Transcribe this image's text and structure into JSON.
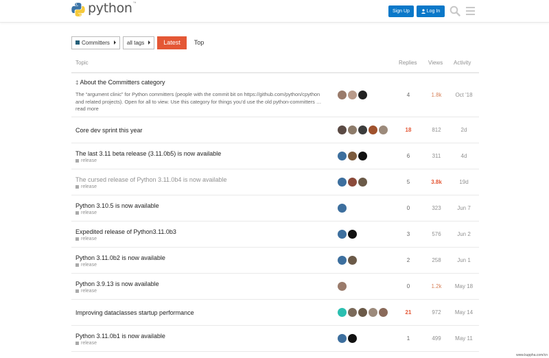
{
  "header": {
    "brand": "python",
    "trademark": "™",
    "signup_label": "Sign Up",
    "login_label": "Log In",
    "search_icon": "search-icon",
    "menu_icon": "hamburger-menu-icon"
  },
  "nav": {
    "category_label": "Committers",
    "tags_label": "all tags",
    "latest_label": "Latest",
    "top_label": "Top"
  },
  "columns": {
    "topic": "Topic",
    "replies": "Replies",
    "views": "Views",
    "activity": "Activity"
  },
  "topics": [
    {
      "pinned": true,
      "title": "About the Committers category",
      "excerpt": "The “argument clinic” for Python committers (people with the commit bit on https://github.com/python/cpython and related projects). Open for all to view. Use this category for things you’d use the old python-committers … read more",
      "tag": "",
      "avatars": [
        "#9a7b6b",
        "#b89a8a",
        "#222222"
      ],
      "replies": "4",
      "views": "1.8k",
      "activity": "Oct '18"
    },
    {
      "title": "Core dev sprint this year",
      "tag": "",
      "avatars": [
        "#5a4a44",
        "#8d7b6a",
        "#3c3c3c",
        "#a0522d",
        "#9c8a7b"
      ],
      "replies": "18",
      "views": "812",
      "activity": "2d"
    },
    {
      "title": "The last 3.11 beta release (3.11.0b5) is now available",
      "tag": "release",
      "avatars": [
        "#3d6f9e",
        "#7b5a3d",
        "#111111"
      ],
      "replies": "6",
      "views": "311",
      "activity": "4d"
    },
    {
      "title": "The cursed release of Python 3.11.0b4 is now available",
      "muted": true,
      "tag": "release",
      "avatars": [
        "#3d6f9e",
        "#8b4a3a",
        "#6b5a48"
      ],
      "replies": "5",
      "views": "3.8k",
      "activity": "19d"
    },
    {
      "title": "Python 3.10.5 is now available",
      "tag": "release",
      "avatars": [
        "#3d6f9e"
      ],
      "replies": "0",
      "views": "323",
      "activity": "Jun 7"
    },
    {
      "title": "Expedited release of Python3.11.0b3",
      "tag": "release",
      "avatars": [
        "#3d6f9e",
        "#111111"
      ],
      "replies": "3",
      "views": "576",
      "activity": "Jun 2"
    },
    {
      "title": "Python 3.11.0b2 is now available",
      "tag": "release",
      "avatars": [
        "#3d6f9e",
        "#6b5a48"
      ],
      "replies": "2",
      "views": "258",
      "activity": "Jun 1"
    },
    {
      "title": "Python 3.9.13 is now available",
      "tag": "release",
      "avatars": [
        "#9a7b6b"
      ],
      "replies": "0",
      "views": "1.2k",
      "activity": "May 18"
    },
    {
      "title": "Improving dataclasses startup performance",
      "tag": "",
      "avatars": [
        "#2bbfb0",
        "#7b6a5a",
        "#6b5a48",
        "#9c8a7b",
        "#8a6a5a"
      ],
      "replies": "21",
      "views": "972",
      "activity": "May 14"
    },
    {
      "title": "Python 3.11.0b1 is now available",
      "tag": "release",
      "avatars": [
        "#3d6f9e",
        "#111111"
      ],
      "replies": "1",
      "views": "499",
      "activity": "May 11"
    }
  ],
  "watermark": "www.kuppha.com/cn"
}
